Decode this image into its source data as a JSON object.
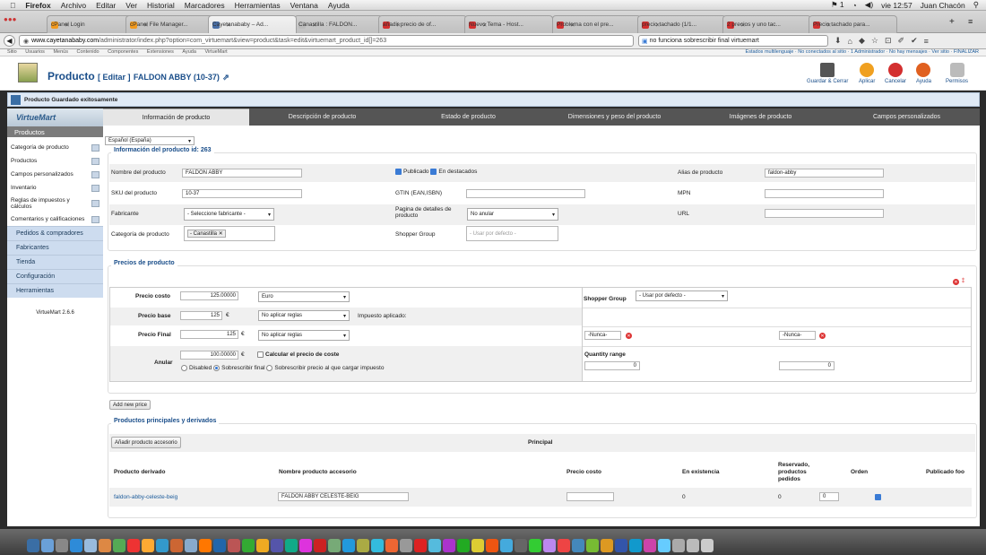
{
  "mac": {
    "app": "Firefox",
    "menu": [
      "Archivo",
      "Editar",
      "Ver",
      "Historial",
      "Marcadores",
      "Herramientas",
      "Ventana",
      "Ayuda"
    ],
    "clock": "vie 12:57",
    "user": "Juan Chacón",
    "status": "1"
  },
  "browser": {
    "tabs": [
      {
        "label": "cPanel Login",
        "color": "#f29a1e"
      },
      {
        "label": "cPanel File Manager...",
        "color": "#f29a1e"
      },
      {
        "label": "Cayetanababy – Ad...",
        "color": "#4a6fa5",
        "active": true
      },
      {
        "label": "Canastilla : FALDON...",
        "color": "#bbbbbb"
      },
      {
        "label": "añadir precio de of...",
        "color": "#d32f2f"
      },
      {
        "label": "Nuevo Tema - Host...",
        "color": "#d32f2f"
      },
      {
        "label": "Problema con el pre...",
        "color": "#d32f2f"
      },
      {
        "label": "precio tachado (1/1...",
        "color": "#d32f2f"
      },
      {
        "label": "2 precios y uno tac...",
        "color": "#d32f2f"
      },
      {
        "label": "Precio tachado para...",
        "color": "#d32f2f"
      }
    ],
    "url_domain": "www.cayetanababy.com",
    "url_path": "/administrator/index.php?option=com_virtuemart&view=product&task=edit&virtuemart_product_id[]=263",
    "search": "no funciona sobrescribir final virtuemart"
  },
  "joomla": {
    "top_menu": [
      "Sitio",
      "Usuarios",
      "Menús",
      "Contenido",
      "Componentes",
      "Extensiones",
      "Ayuda",
      "VirtueMart"
    ],
    "top_right": "Estados multilenguaje · No conectados al sitio · 1 Administrador · No hay mensajes · Ver sitio · FINALIZAR"
  },
  "header": {
    "title": "Producto",
    "edit": "[ Editar ]",
    "name": "FALDON ABBY (10-37)"
  },
  "toolbar": [
    {
      "label": "Guardar & Cerrar",
      "color": "#555"
    },
    {
      "label": "Aplicar",
      "color": "#f0a020"
    },
    {
      "label": "Cancelar",
      "color": "#d32f2f"
    },
    {
      "label": "Ayuda",
      "color": "#e06020"
    },
    {
      "label": "Permisos",
      "color": "#bbb"
    }
  ],
  "message": "Producto Guardado exitosamente",
  "sidebar": {
    "logo": "VirtueMart",
    "section": "Productos",
    "items": [
      "Categoría de producto",
      "Productos",
      "Campos personalizados",
      "Inventario",
      "Reglas de impuestos y cálculos",
      "Comentarios y calificaciones"
    ],
    "cats": [
      "Pedidos & compradores",
      "Fabricantes",
      "Tienda",
      "Configuración",
      "Herramientas"
    ],
    "version": "VirtueMart 2.6.6"
  },
  "tabs": [
    "Información de producto",
    "Descripción de producto",
    "Estado de producto",
    "Dimensiones y peso del producto",
    "Imágenes de producto",
    "Campos personalizados"
  ],
  "lang": "Español (España)",
  "info": {
    "legend": "Información del producto id: 263",
    "name_label": "Nombre del producto",
    "name": "FALDON ABBY",
    "published": "Publicado",
    "featured": "En destacados",
    "alias_label": "Alias de producto",
    "alias": "faldon-abby",
    "sku_label": "SKU del producto",
    "sku": "10-37",
    "gtin_label": "GTIN (EAN,ISBN)",
    "mpn_label": "MPN",
    "manuf_label": "Fabricante",
    "manuf": "- Seleccione fabricante -",
    "page_label": "Pagina de detalles de producto",
    "page": "No anular",
    "url_label": "URL",
    "cat_label": "Categoría de producto",
    "cat": "- Canastilla",
    "shopper_label": "Shopper Group",
    "shopper_ph": "- Usar por defecto -"
  },
  "prices": {
    "legend": "Precios de producto",
    "cost_label": "Precio costo",
    "cost": "125.00000",
    "currency": "Euro",
    "sg_label": "Shopper Group",
    "sg": "- Usar por defecto -",
    "base_label": "Precio base",
    "base": "125",
    "euro": "€",
    "rules": "No aplicar reglas",
    "tax": "Impuesto aplicado:",
    "final_label": "Precio Final",
    "final": "125",
    "never1": "-Nunca-",
    "never2": "-Nunca-",
    "override_label": "Anular",
    "override": "100.00000",
    "calc": "Calcular el precio de coste",
    "qty_label": "Quantity range",
    "qty1": "0",
    "qty2": "0",
    "opt_disabled": "Disabled",
    "opt_final": "Sobrescribir final",
    "opt_tax": "Sobrescribir precio al que cargar impuesto",
    "add": "Add new price"
  },
  "related": {
    "legend": "Productos principales y derivados",
    "add": "Añadir producto accesorio",
    "principal": "Principal",
    "cols": [
      "Producto derivado",
      "Nombre producto accesorio",
      "Precio costo",
      "En existencia",
      "Reservado, productos pedidos",
      "Orden",
      "Publicado foo"
    ],
    "row": {
      "slug": "faldon-abby-celeste-beig",
      "name": "FALDON ABBY CELESTE-BEIG",
      "stock": "0",
      "reserved": "0",
      "order": "0"
    }
  }
}
